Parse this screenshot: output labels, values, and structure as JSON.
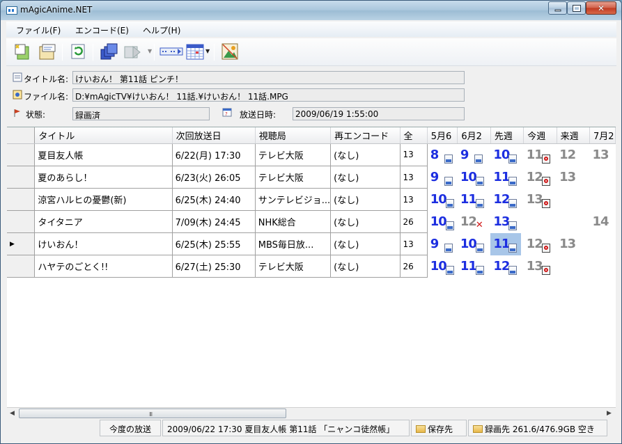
{
  "window": {
    "title": "mAgicAnime.NET"
  },
  "menu": [
    "ファイル(F)",
    "エンコード(E)",
    "ヘルプ(H)"
  ],
  "toolbar_icons": [
    "new-icon",
    "properties-icon",
    "refresh-icon",
    "copy-icon",
    "play-icon",
    "encode-icon",
    "calendar-icon",
    "image-icon"
  ],
  "info": {
    "title_label": "タイトル名:",
    "title_value": "けいおん！ 第11話 ピンチ！",
    "file_label": "ファイル名:",
    "file_value": "D:¥mAgicTV¥けいおん！ 11話.¥けいおん！ 11話.MPG",
    "status_label": "状態:",
    "status_value": "録画済",
    "airtime_label": "放送日時:",
    "airtime_value": "2009/06/19 1:55:00"
  },
  "grid": {
    "columns": [
      "タイトル",
      "次回放送日",
      "視聴局",
      "再エンコード",
      "全",
      "5月6",
      "6月2",
      "先週",
      "今週",
      "来週",
      "7月2"
    ],
    "rows": [
      {
        "title": "夏目友人帳",
        "next": "6/22(月) 17:30",
        "station": "テレビ大阪",
        "reencode": "(なし)",
        "total": "13",
        "eps": [
          {
            "n": "8",
            "c": "blue",
            "i": "doc"
          },
          {
            "n": "9",
            "c": "blue",
            "i": "doc"
          },
          {
            "n": "10",
            "c": "blue",
            "i": "doc"
          },
          {
            "n": "11",
            "c": "gray",
            "i": "rec"
          },
          {
            "n": "12",
            "c": "gray",
            "i": ""
          },
          {
            "n": "13",
            "c": "gray",
            "i": ""
          }
        ]
      },
      {
        "title": "夏のあらし！",
        "next": "6/23(火) 26:05",
        "station": "テレビ大阪",
        "reencode": "(なし)",
        "total": "13",
        "eps": [
          {
            "n": "9",
            "c": "blue",
            "i": "doc"
          },
          {
            "n": "10",
            "c": "blue",
            "i": "doc"
          },
          {
            "n": "11",
            "c": "blue",
            "i": "doc"
          },
          {
            "n": "12",
            "c": "gray",
            "i": "rec"
          },
          {
            "n": "13",
            "c": "gray",
            "i": ""
          },
          {
            "n": "",
            "c": "",
            "i": ""
          }
        ]
      },
      {
        "title": "涼宮ハルヒの憂鬱(新)",
        "next": "6/25(木) 24:40",
        "station": "サンテレビジョ...",
        "reencode": "(なし)",
        "total": "13",
        "eps": [
          {
            "n": "10",
            "c": "blue",
            "i": "doc"
          },
          {
            "n": "11",
            "c": "blue",
            "i": "doc"
          },
          {
            "n": "12",
            "c": "blue",
            "i": "doc"
          },
          {
            "n": "13",
            "c": "gray",
            "i": "rec"
          },
          {
            "n": "",
            "c": "",
            "i": ""
          },
          {
            "n": "",
            "c": "",
            "i": ""
          }
        ]
      },
      {
        "title": "タイタニア",
        "next": "7/09(木) 24:45",
        "station": "NHK総合",
        "reencode": "(なし)",
        "total": "26",
        "eps": [
          {
            "n": "10",
            "c": "blue",
            "i": "doc"
          },
          {
            "n": "12",
            "c": "gray",
            "i": "x"
          },
          {
            "n": "13",
            "c": "blue",
            "i": "doc"
          },
          {
            "n": "",
            "c": "",
            "i": ""
          },
          {
            "n": "",
            "c": "",
            "i": ""
          },
          {
            "n": "14",
            "c": "gray",
            "i": ""
          }
        ]
      },
      {
        "title": "けいおん！",
        "next": "6/25(木) 25:55",
        "station": "MBS毎日放...",
        "reencode": "(なし)",
        "total": "13",
        "current": true,
        "eps": [
          {
            "n": "9",
            "c": "blue",
            "i": "doc"
          },
          {
            "n": "10",
            "c": "blue",
            "i": "doc"
          },
          {
            "n": "11",
            "c": "blue",
            "i": "doc",
            "hl": true
          },
          {
            "n": "12",
            "c": "gray",
            "i": "rec"
          },
          {
            "n": "13",
            "c": "gray",
            "i": ""
          },
          {
            "n": "",
            "c": "",
            "i": ""
          }
        ]
      },
      {
        "title": "ハヤテのごとく!!",
        "next": "6/27(土) 25:30",
        "station": "テレビ大阪",
        "reencode": "(なし)",
        "total": "26",
        "eps": [
          {
            "n": "10",
            "c": "blue",
            "i": "doc"
          },
          {
            "n": "11",
            "c": "blue",
            "i": "doc"
          },
          {
            "n": "12",
            "c": "blue",
            "i": "doc"
          },
          {
            "n": "13",
            "c": "gray",
            "i": "rec"
          },
          {
            "n": "",
            "c": "",
            "i": ""
          },
          {
            "n": "",
            "c": "",
            "i": ""
          }
        ]
      }
    ]
  },
  "status": {
    "next_button": "今度の放送",
    "next_info": "2009/06/22 17:30 夏目友人帳 第11話 「ニャンコ徒然帳」",
    "save_folder": "保存先",
    "record_folder": "録画先 261.6/476.9GB 空き"
  }
}
